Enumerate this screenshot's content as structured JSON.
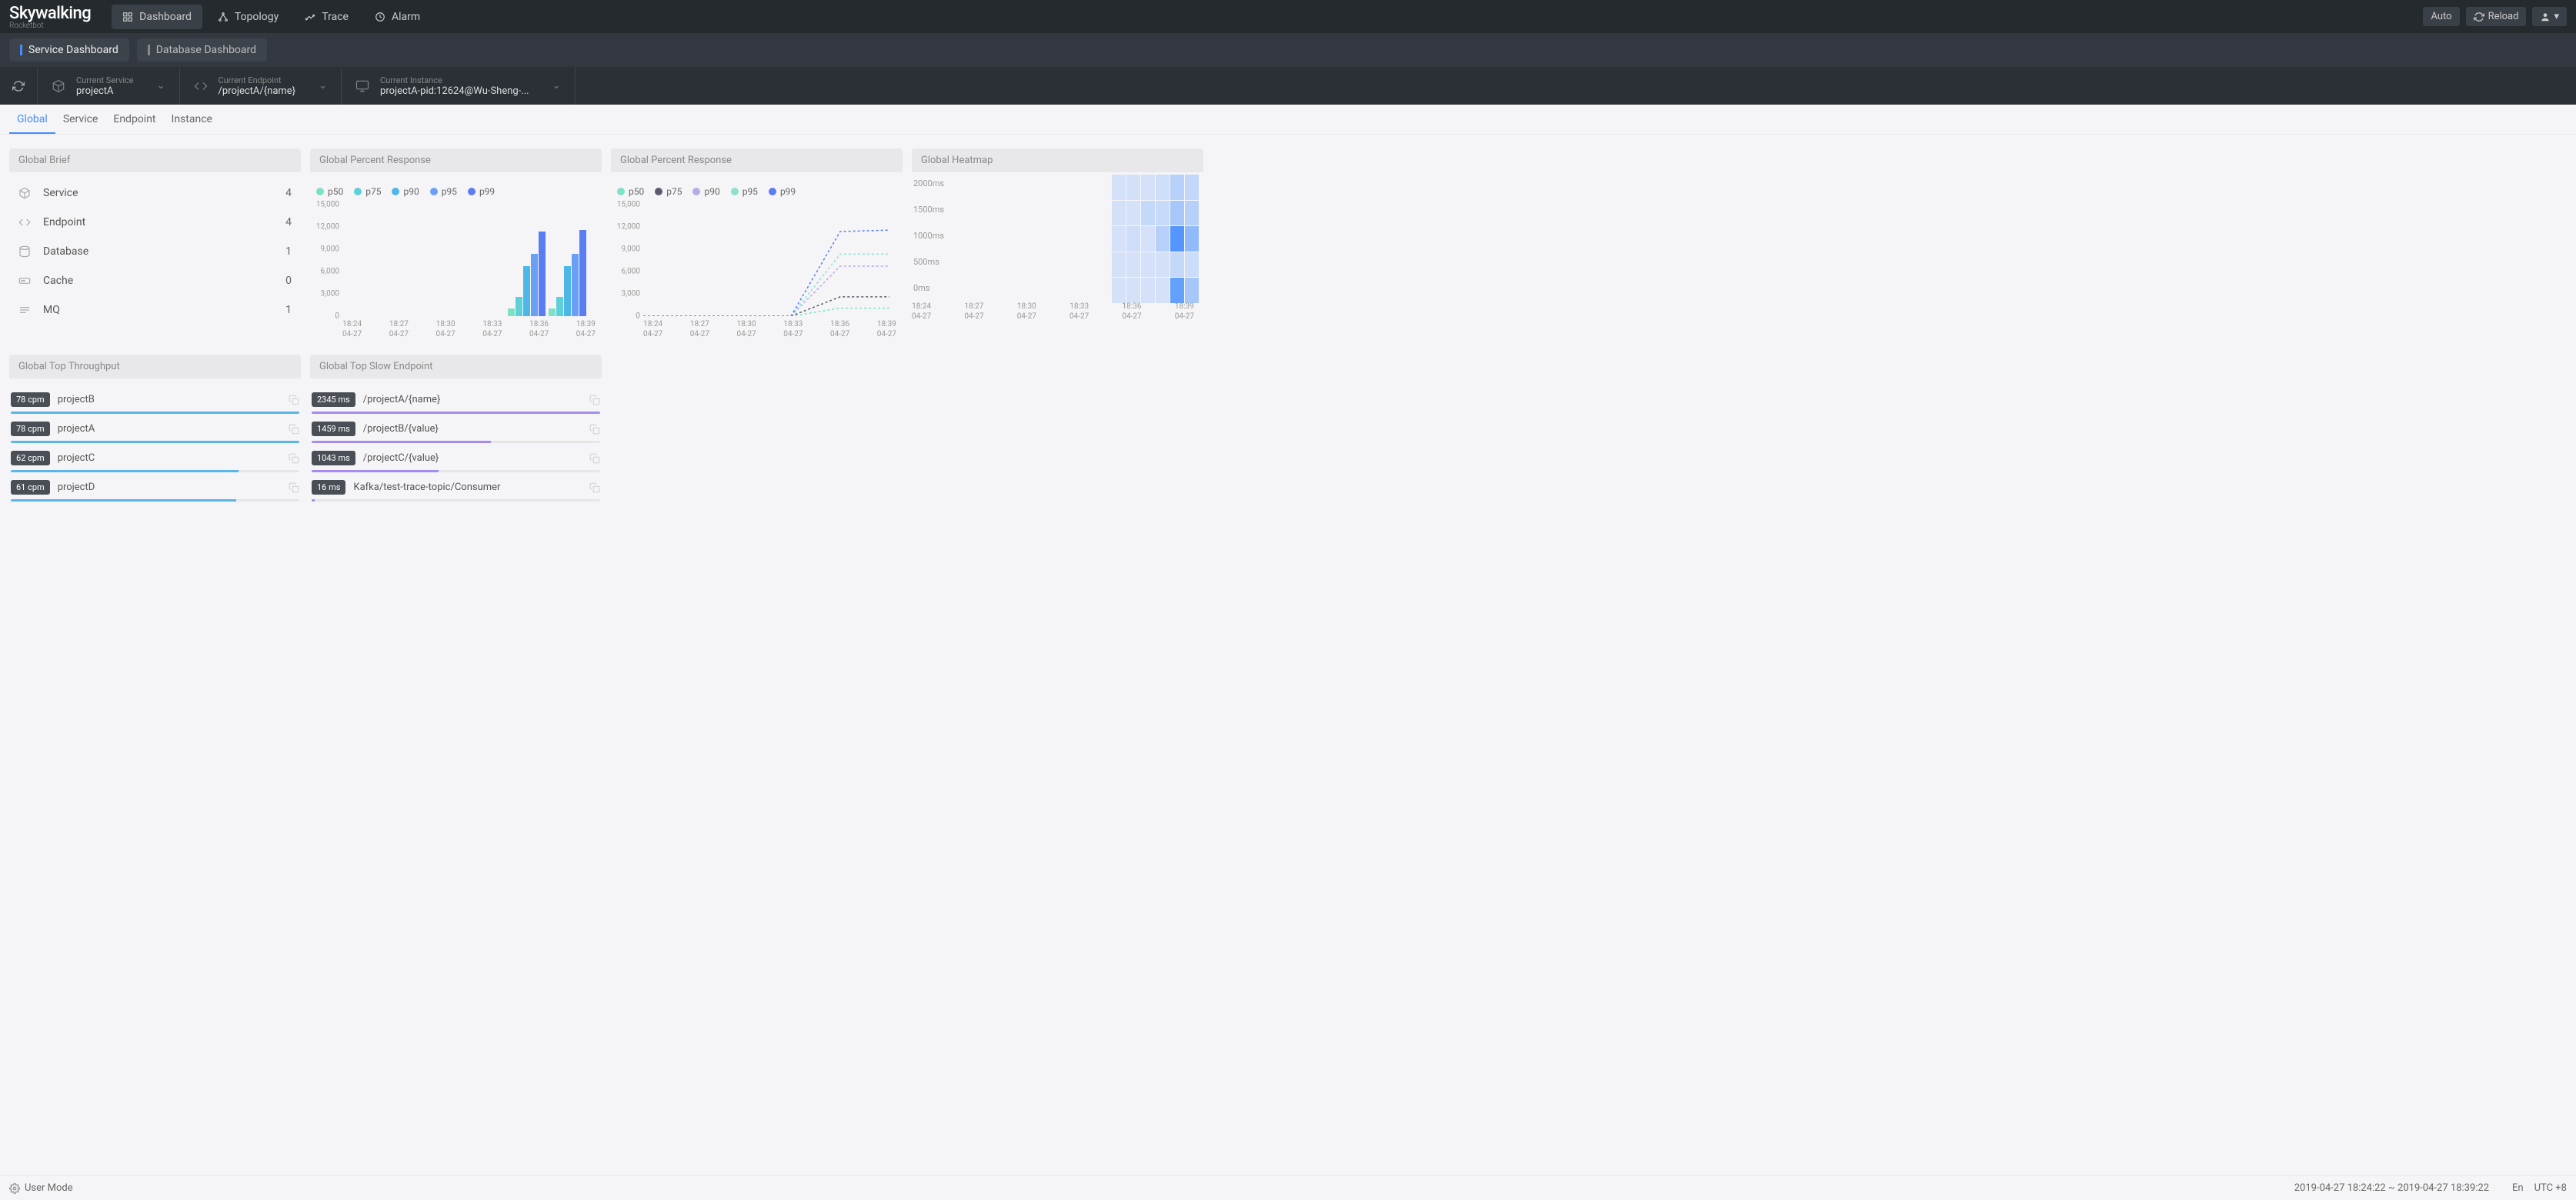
{
  "brand": {
    "main": "Skywalking",
    "sub": "Rocketbot"
  },
  "nav": [
    {
      "label": "Dashboard",
      "icon": "dashboard"
    },
    {
      "label": "Topology",
      "icon": "topology"
    },
    {
      "label": "Trace",
      "icon": "trace"
    },
    {
      "label": "Alarm",
      "icon": "alarm"
    }
  ],
  "top_buttons": {
    "auto": "Auto",
    "reload": "Reload"
  },
  "sub_tabs": {
    "service": "Service Dashboard",
    "database": "Database Dashboard"
  },
  "selectors": {
    "service": {
      "label": "Current Service",
      "value": "projectA"
    },
    "endpoint": {
      "label": "Current Endpoint",
      "value": "/projectA/{name}"
    },
    "instance": {
      "label": "Current Instance",
      "value": "projectA-pid:12624@Wu-Sheng-..."
    }
  },
  "tabs": [
    "Global",
    "Service",
    "Endpoint",
    "Instance"
  ],
  "active_tab": 0,
  "brief": {
    "title": "Global Brief",
    "rows": [
      {
        "icon": "cube",
        "label": "Service",
        "value": "4"
      },
      {
        "icon": "code",
        "label": "Endpoint",
        "value": "4"
      },
      {
        "icon": "db",
        "label": "Database",
        "value": "1"
      },
      {
        "icon": "cache",
        "label": "Cache",
        "value": "0"
      },
      {
        "icon": "mq",
        "label": "MQ",
        "value": "1"
      }
    ]
  },
  "chart_data": [
    {
      "title": "Global Percent Response",
      "type": "bar",
      "series_names": [
        "p50",
        "p75",
        "p90",
        "p95",
        "p99"
      ],
      "colors": [
        "#7fe0c9",
        "#5dd0d8",
        "#4db8e8",
        "#6b9ff5",
        "#5a7ef2"
      ],
      "categories": [
        "18:24 04-27",
        "18:27 04-27",
        "18:30 04-27",
        "18:33 04-27",
        "18:36 04-27",
        "18:39 04-27"
      ],
      "yticks": [
        "0",
        "3,000",
        "6,000",
        "9,000",
        "12,000",
        "15,000"
      ],
      "ylim": [
        0,
        15000
      ],
      "series": [
        {
          "name": "p50",
          "values": [
            0,
            0,
            0,
            0,
            1200,
            1200
          ]
        },
        {
          "name": "p75",
          "values": [
            0,
            0,
            0,
            0,
            2900,
            2900
          ]
        },
        {
          "name": "p90",
          "values": [
            0,
            0,
            0,
            0,
            7500,
            7500
          ]
        },
        {
          "name": "p95",
          "values": [
            0,
            0,
            0,
            0,
            9300,
            9300
          ]
        },
        {
          "name": "p99",
          "values": [
            0,
            0,
            0,
            0,
            12700,
            12900
          ]
        }
      ]
    },
    {
      "title": "Global Percent Response",
      "type": "line",
      "series_names": [
        "p50",
        "p75",
        "p90",
        "p95",
        "p99"
      ],
      "colors": [
        "#7fe0c9",
        "#5e5a6b",
        "#b9a9e8",
        "#8de0d0",
        "#5a7ef2"
      ],
      "categories": [
        "18:24 04-27",
        "18:27 04-27",
        "18:30 04-27",
        "18:33 04-27",
        "18:36 04-27",
        "18:39 04-27"
      ],
      "yticks": [
        "0",
        "3,000",
        "6,000",
        "9,000",
        "12,000",
        "15,000"
      ],
      "ylim": [
        0,
        15000
      ],
      "series": [
        {
          "name": "p50",
          "values": [
            0,
            0,
            0,
            0,
            1200,
            1200
          ]
        },
        {
          "name": "p75",
          "values": [
            0,
            0,
            0,
            0,
            2900,
            2900
          ]
        },
        {
          "name": "p90",
          "values": [
            0,
            0,
            0,
            0,
            7500,
            7500
          ]
        },
        {
          "name": "p95",
          "values": [
            0,
            0,
            0,
            0,
            9300,
            9300
          ]
        },
        {
          "name": "p99",
          "values": [
            0,
            0,
            0,
            0,
            12700,
            12900
          ]
        }
      ]
    },
    {
      "title": "Global Heatmap",
      "type": "heatmap",
      "yticks": [
        "0ms",
        "500ms",
        "1000ms",
        "1500ms",
        "2000ms"
      ],
      "categories": [
        "18:24 04-27",
        "18:27 04-27",
        "18:30 04-27",
        "18:33 04-27",
        "18:36 04-27",
        "18:39 04-27"
      ],
      "intensity": [
        [
          0.1,
          0.12,
          0.1,
          0.14,
          0.3,
          0.22
        ],
        [
          0.12,
          0.1,
          0.2,
          0.18,
          0.4,
          0.3
        ],
        [
          0.1,
          0.14,
          0.1,
          0.3,
          0.95,
          0.55
        ],
        [
          0.1,
          0.1,
          0.1,
          0.12,
          0.2,
          0.15
        ],
        [
          0.1,
          0.1,
          0.1,
          0.1,
          0.85,
          0.4
        ]
      ]
    }
  ],
  "throughput": {
    "title": "Global Top Throughput",
    "items": [
      {
        "badge": "78 cpm",
        "name": "projectB",
        "pct": 100
      },
      {
        "badge": "78 cpm",
        "name": "projectA",
        "pct": 100
      },
      {
        "badge": "62 cpm",
        "name": "projectC",
        "pct": 79
      },
      {
        "badge": "61 cpm",
        "name": "projectD",
        "pct": 78
      }
    ],
    "bar_color": "#5ab5e8"
  },
  "slow": {
    "title": "Global Top Slow Endpoint",
    "items": [
      {
        "badge": "2345 ms",
        "name": "/projectA/{name}",
        "pct": 100
      },
      {
        "badge": "1459 ms",
        "name": "/projectB/{value}",
        "pct": 62
      },
      {
        "badge": "1043 ms",
        "name": "/projectC/{value}",
        "pct": 44
      },
      {
        "badge": "16 ms",
        "name": "Kafka/test-trace-topic/Consumer",
        "pct": 1
      }
    ],
    "bar_color": "#a68cf0"
  },
  "footer": {
    "mode": "User Mode",
    "range": "2019-04-27 18:24:22 ~ 2019-04-27 18:39:22",
    "lang": "En",
    "tz": "UTC +8"
  }
}
